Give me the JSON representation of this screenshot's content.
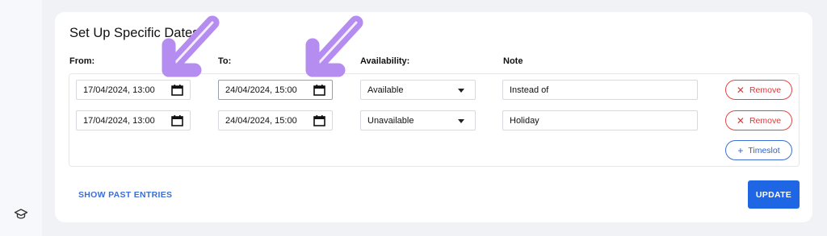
{
  "card": {
    "title": "Set Up Specific Dates",
    "headers": {
      "from": "From:",
      "to": "To:",
      "availability": "Availability:",
      "note": "Note"
    },
    "rows": [
      {
        "from": "17/04/2024, 13:00",
        "to": "24/04/2024, 15:00",
        "availability": "Available",
        "note": "Instead of",
        "remove_label": "Remove"
      },
      {
        "from": "17/04/2024, 13:00",
        "to": "24/04/2024, 15:00",
        "availability": "Unavailable",
        "note": "Holiday",
        "remove_label": "Remove"
      }
    ],
    "add_timeslot_label": "Timeslot",
    "show_past_label": "SHOW PAST ENTRIES",
    "update_label": "UPDATE"
  },
  "icons": {
    "calendar": "calendar-icon",
    "remove": "x-icon",
    "add": "plus-icon",
    "sidebar": "graduation-cap-icon",
    "annotation": "arrow-annotation-icon"
  },
  "colors": {
    "primary": "#1f66e5",
    "danger": "#e04848",
    "annotation": "#b58cf0"
  }
}
